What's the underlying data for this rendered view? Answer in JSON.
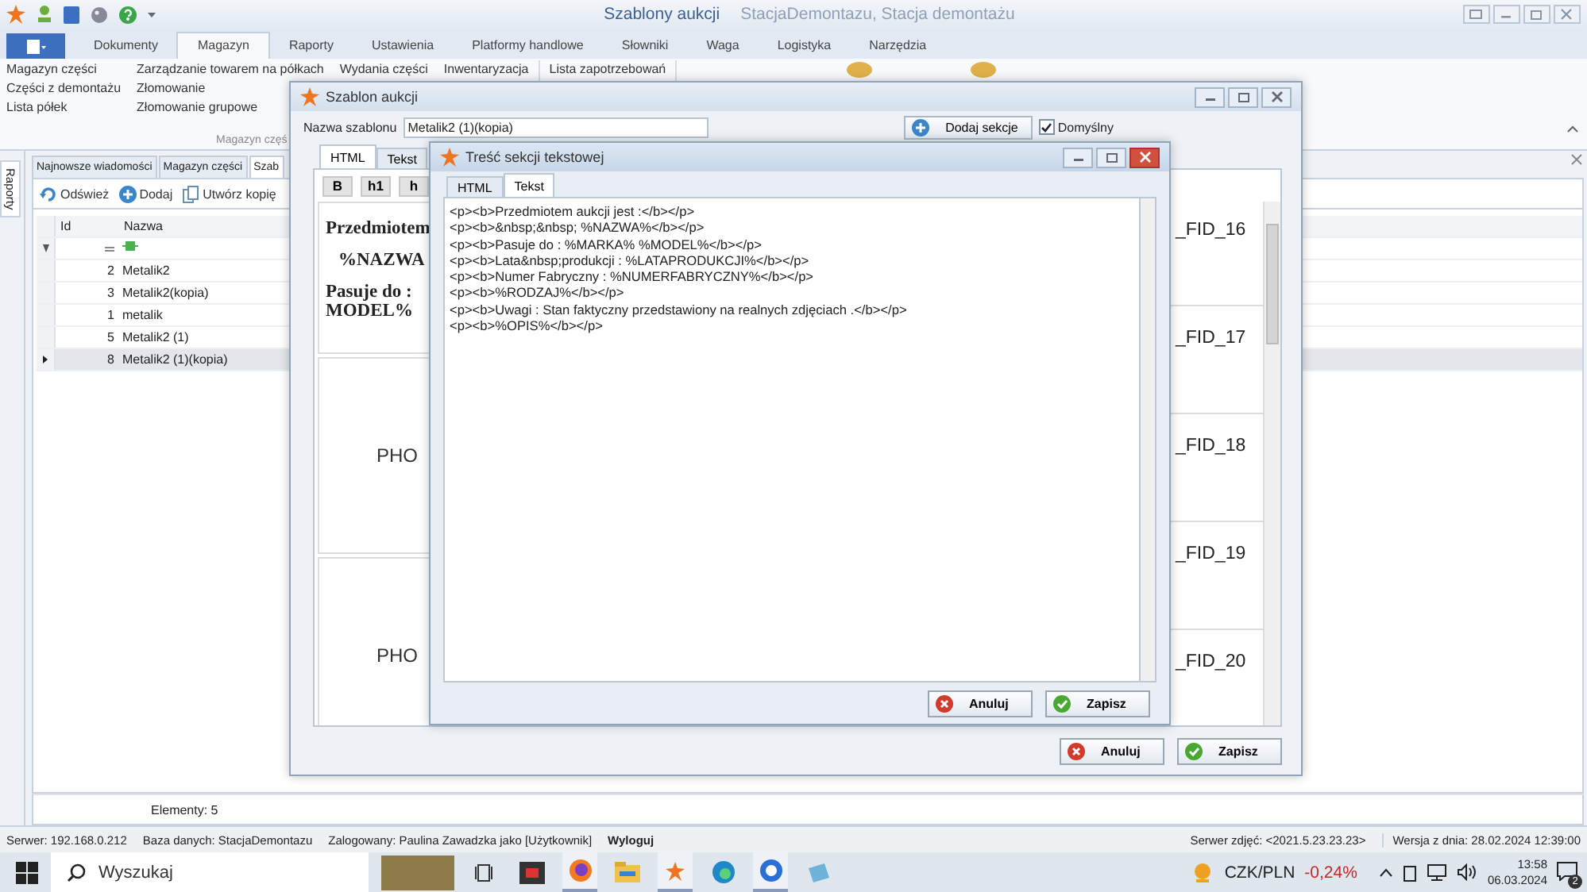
{
  "window": {
    "title": "Szablony aukcji",
    "subtitle": "StacjaDemontazu, Stacja demontażu"
  },
  "ribbon_tabs": [
    {
      "label": "Dokumenty",
      "selected": false
    },
    {
      "label": "Magazyn",
      "selected": true
    },
    {
      "label": "Raporty",
      "selected": false
    },
    {
      "label": "Ustawienia",
      "selected": false
    },
    {
      "label": "Platformy handlowe",
      "selected": false
    },
    {
      "label": "Słowniki",
      "selected": false
    },
    {
      "label": "Waga",
      "selected": false
    },
    {
      "label": "Logistyka",
      "selected": false
    },
    {
      "label": "Narzędzia",
      "selected": false
    }
  ],
  "ribbon_groups": [
    {
      "label": "Magazyn częś",
      "columns": [
        [
          "Magazyn części",
          "Części z demontażu",
          "Lista półek"
        ],
        [
          "Zarządzanie towarem na półkach",
          "Złomowanie",
          "Złomowanie grupowe"
        ],
        [
          "Wydania części"
        ],
        [
          "Inwentaryzacja"
        ]
      ]
    },
    {
      "columns": [
        [
          "Lista zapotrzebowań"
        ]
      ]
    }
  ],
  "side_tab": "Raporty",
  "document_tabs": [
    {
      "label": "Najnowsze wiadomości",
      "selected": false
    },
    {
      "label": "Magazyn części",
      "selected": false
    },
    {
      "label": "Szab",
      "selected": true
    }
  ],
  "toolbar": [
    {
      "label": "Odśwież",
      "kind": "refresh"
    },
    {
      "label": "Dodaj",
      "kind": "add"
    },
    {
      "label": "Utwórz kopię",
      "kind": "copy"
    }
  ],
  "grid": {
    "columns": [
      "Id",
      "Nazwa"
    ],
    "rows": [
      {
        "id": "2",
        "name": "Metalik2",
        "selected": false
      },
      {
        "id": "3",
        "name": "Metalik2(kopia)",
        "selected": false
      },
      {
        "id": "1",
        "name": "metalik",
        "selected": false
      },
      {
        "id": "5",
        "name": "Metalik2 (1)",
        "selected": false
      },
      {
        "id": "8",
        "name": "Metalik2 (1)(kopia)",
        "selected": true
      }
    ]
  },
  "footer": "Elementy: 5",
  "status_bar": {
    "left": [
      {
        "text": "Serwer: 192.168.0.212",
        "kind": "info"
      },
      {
        "text": "Baza danych: StacjaDemontazu",
        "kind": "info"
      },
      {
        "text": "Zalogowany: Paulina Zawadzka jako [Użytkownik]",
        "kind": "info"
      },
      {
        "text": "Wyloguj",
        "kind": "link"
      }
    ],
    "right": [
      "Serwer zdjęć: <2021.5.23.23.23>",
      "Wersja z dnia: 28.02.2024 12:39:00"
    ]
  },
  "taskbar": {
    "search_placeholder": "Wyszukaj",
    "ticker": "CZK/PLN",
    "change": "-0,24%",
    "time": "13:58",
    "date": "06.03.2024",
    "notifications": "2"
  },
  "template_dialog": {
    "title": "Szablon aukcji",
    "name_label": "Nazwa szablonu",
    "name_value": "Metalik2 (1)(kopia)",
    "add_section_button": "Dodaj sekcje",
    "default_checkbox": {
      "label": "Domyślny",
      "checked": true
    },
    "tabs": [
      {
        "label": "HTML",
        "selected": true
      },
      {
        "label": "Tekst",
        "selected": false
      }
    ],
    "format_buttons": [
      "B",
      "h1",
      "h"
    ],
    "preview": {
      "text_lines": [
        "Przedmiotem",
        "%NAZWA",
        "Pasuje do :",
        "MODEL%"
      ],
      "photo_labels": [
        "PHO",
        "PHO"
      ],
      "field_labels": [
        "_FID_16",
        "_FID_17",
        "_FID_18",
        "_FID_19",
        "_FID_20"
      ]
    },
    "buttons": [
      {
        "label": "Anuluj",
        "kind": "cancel"
      },
      {
        "label": "Zapisz",
        "kind": "save"
      }
    ]
  },
  "section_dialog": {
    "title": "Treść sekcji tekstowej",
    "tabs": [
      {
        "label": "HTML",
        "selected": false
      },
      {
        "label": "Tekst",
        "selected": true
      }
    ],
    "content_lines": [
      "<p><b>Przedmiotem aukcji jest :</b></p>",
      "<p><b>&nbsp;&nbsp; %NAZWA%</b></p>",
      "<p><b>Pasuje do : %MARKA% %MODEL%</b></p>",
      "<p><b>Lata&nbsp;produkcji : %LATAPRODUKCJI%</b></p>",
      "<p><b>Numer Fabryczny : %NUMERFABRYCZNY%</b></p>",
      "<p><b>%RODZAJ%</b></p>",
      "<p><b>Uwagi : Stan faktyczny przedstawiony na realnych zdjęciach .</b></p>",
      "<p><b>%OPIS%</b></p>"
    ],
    "buttons": [
      {
        "label": "Anuluj",
        "kind": "cancel"
      },
      {
        "label": "Zapisz",
        "kind": "save"
      }
    ]
  }
}
